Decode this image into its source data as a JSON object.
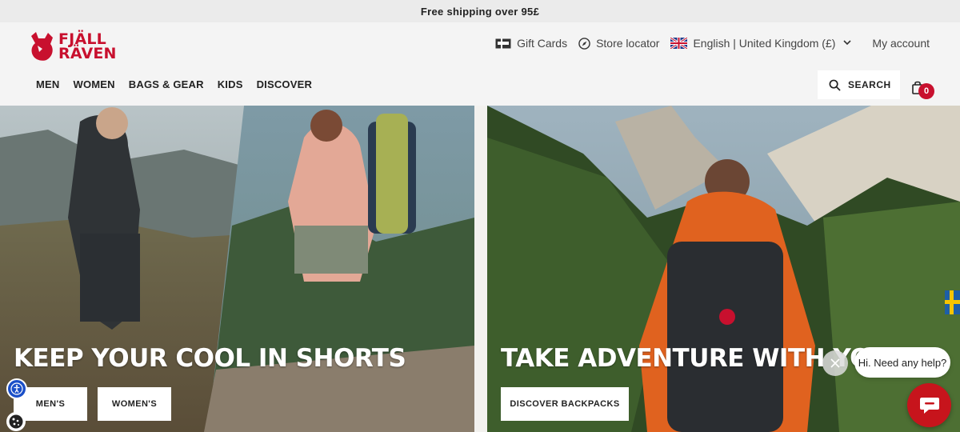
{
  "topbar": {
    "text": "Free shipping over 95£"
  },
  "brand": {
    "line1": "FJÄLL",
    "line2": "RÄVEN",
    "color": "#c8102e"
  },
  "utility": {
    "gift_cards": "Gift Cards",
    "store_locator": "Store locator",
    "locale": "English | United Kingdom (£)",
    "account": "My account"
  },
  "nav": [
    "MEN",
    "WOMEN",
    "BAGS & GEAR",
    "KIDS",
    "DISCOVER"
  ],
  "search": {
    "label": "SEARCH"
  },
  "cart": {
    "count": "0"
  },
  "hero_left": {
    "headline": "KEEP YOUR COOL IN SHORTS",
    "buttons": [
      "MEN'S",
      "WOMEN'S"
    ]
  },
  "hero_right": {
    "headline": "TAKE ADVENTURE WITH YOU",
    "button": "DISCOVER BACKPACKS"
  },
  "chat": {
    "greeting": "Hi. Need any help?"
  },
  "icons": [
    "gift-card-icon",
    "compass-icon",
    "uk-flag-icon",
    "chevron-down-icon",
    "search-icon",
    "bag-icon",
    "accessibility-icon",
    "cookie-icon",
    "sweden-flag-icon",
    "close-icon",
    "chat-icon"
  ]
}
